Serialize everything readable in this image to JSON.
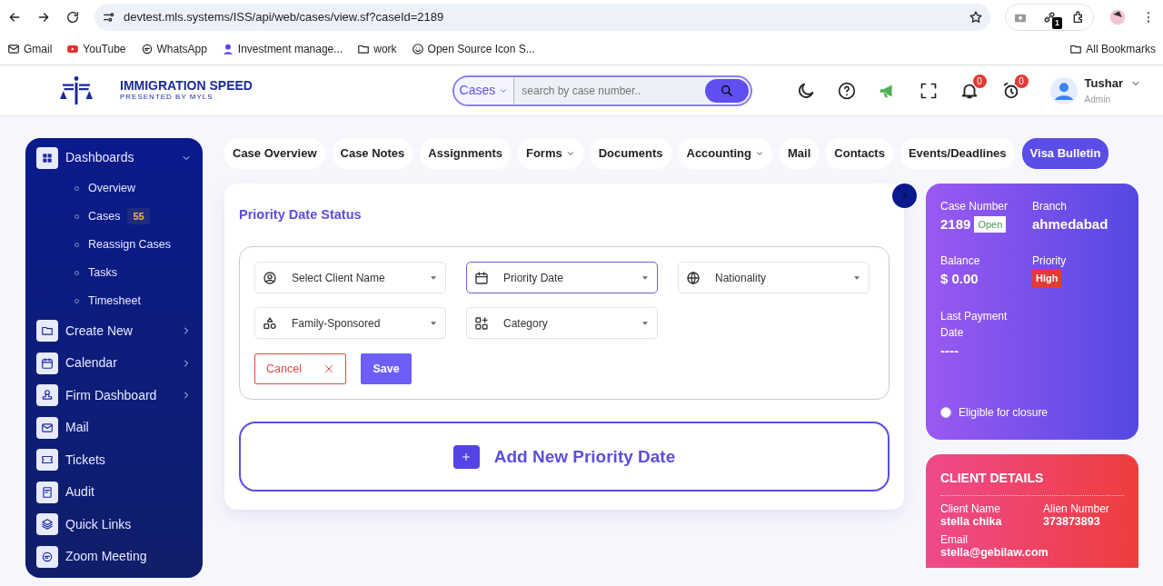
{
  "browser": {
    "url": "devtest.mls.systems/ISS/api/web/cases/view.sf?caseId=2189",
    "extension_badge": "1",
    "bookmarks": [
      {
        "label": "Gmail"
      },
      {
        "label": "YouTube"
      },
      {
        "label": "WhatsApp"
      },
      {
        "label": "Investment manage..."
      },
      {
        "label": "work"
      },
      {
        "label": "Open Source Icon S..."
      }
    ],
    "all_bookmarks": "All Bookmarks"
  },
  "header": {
    "logo_title": "IMMIGRATION SPEED",
    "logo_subtitle": "PRESENTED BY MYLS",
    "search": {
      "scope": "Cases",
      "placeholder": "search by case number.."
    },
    "notification_count": "0",
    "alarm_count": "0",
    "user": {
      "name": "Tushar",
      "role": "Admin"
    }
  },
  "sidebar": {
    "items": [
      {
        "label": "Dashboards",
        "kind": "group",
        "expanded": true,
        "children": [
          {
            "label": "Overview"
          },
          {
            "label": "Cases",
            "badge": "55"
          },
          {
            "label": "Reassign Cases"
          },
          {
            "label": "Tasks"
          },
          {
            "label": "Timesheet"
          }
        ]
      },
      {
        "label": "Create New",
        "kind": "group",
        "expanded": false
      },
      {
        "label": "Calendar",
        "kind": "group",
        "expanded": false
      },
      {
        "label": "Firm Dashboard",
        "kind": "group",
        "expanded": false
      },
      {
        "label": "Mail",
        "kind": "link"
      },
      {
        "label": "Tickets",
        "kind": "link"
      },
      {
        "label": "Audit",
        "kind": "link"
      },
      {
        "label": "Quick Links",
        "kind": "link"
      },
      {
        "label": "Zoom Meeting",
        "kind": "link"
      }
    ]
  },
  "tabs": [
    {
      "label": "Case Overview",
      "selected": false,
      "has_menu": false
    },
    {
      "label": "Case Notes",
      "selected": false,
      "has_menu": false
    },
    {
      "label": "Assignments",
      "selected": false,
      "has_menu": false
    },
    {
      "label": "Forms",
      "selected": false,
      "has_menu": true
    },
    {
      "label": "Documents",
      "selected": false,
      "has_menu": false
    },
    {
      "label": "Accounting",
      "selected": false,
      "has_menu": true
    },
    {
      "label": "Mail",
      "selected": false,
      "has_menu": false
    },
    {
      "label": "Contacts",
      "selected": false,
      "has_menu": false
    },
    {
      "label": "Events/Deadlines",
      "selected": false,
      "has_menu": false
    },
    {
      "label": "Visa Bulletin",
      "selected": true,
      "has_menu": false
    }
  ],
  "panel": {
    "title": "Priority Date Status",
    "fields": [
      {
        "placeholder": "Select Client Name",
        "focused": false
      },
      {
        "placeholder": "Priority Date",
        "focused": true
      },
      {
        "placeholder": "Nationality",
        "focused": false
      },
      {
        "placeholder": "Family-Sponsored",
        "focused": false
      },
      {
        "placeholder": "Category",
        "focused": false
      }
    ],
    "cancel": "Cancel",
    "save": "Save",
    "add": "Add New Priority Date"
  },
  "case_summary": {
    "items": [
      {
        "label": "Case Number",
        "value": "2189",
        "tag": "Open"
      },
      {
        "label": "Branch",
        "value": "ahmedabad"
      },
      {
        "label": "Balance",
        "value": "$ 0.00"
      },
      {
        "label": "Priority",
        "tag": "High"
      },
      {
        "label": "Last Payment Date",
        "value": "----"
      }
    ],
    "eligible": {
      "label": "Eligible for closure",
      "checked": false
    }
  },
  "client_details": {
    "title": "CLIENT DETAILS",
    "items": [
      {
        "label": "Client Name",
        "value": "stella chika"
      },
      {
        "label": "Alien Number",
        "value": "373873893"
      },
      {
        "label": "Email",
        "value": "stella@gebilaw.com"
      }
    ]
  }
}
